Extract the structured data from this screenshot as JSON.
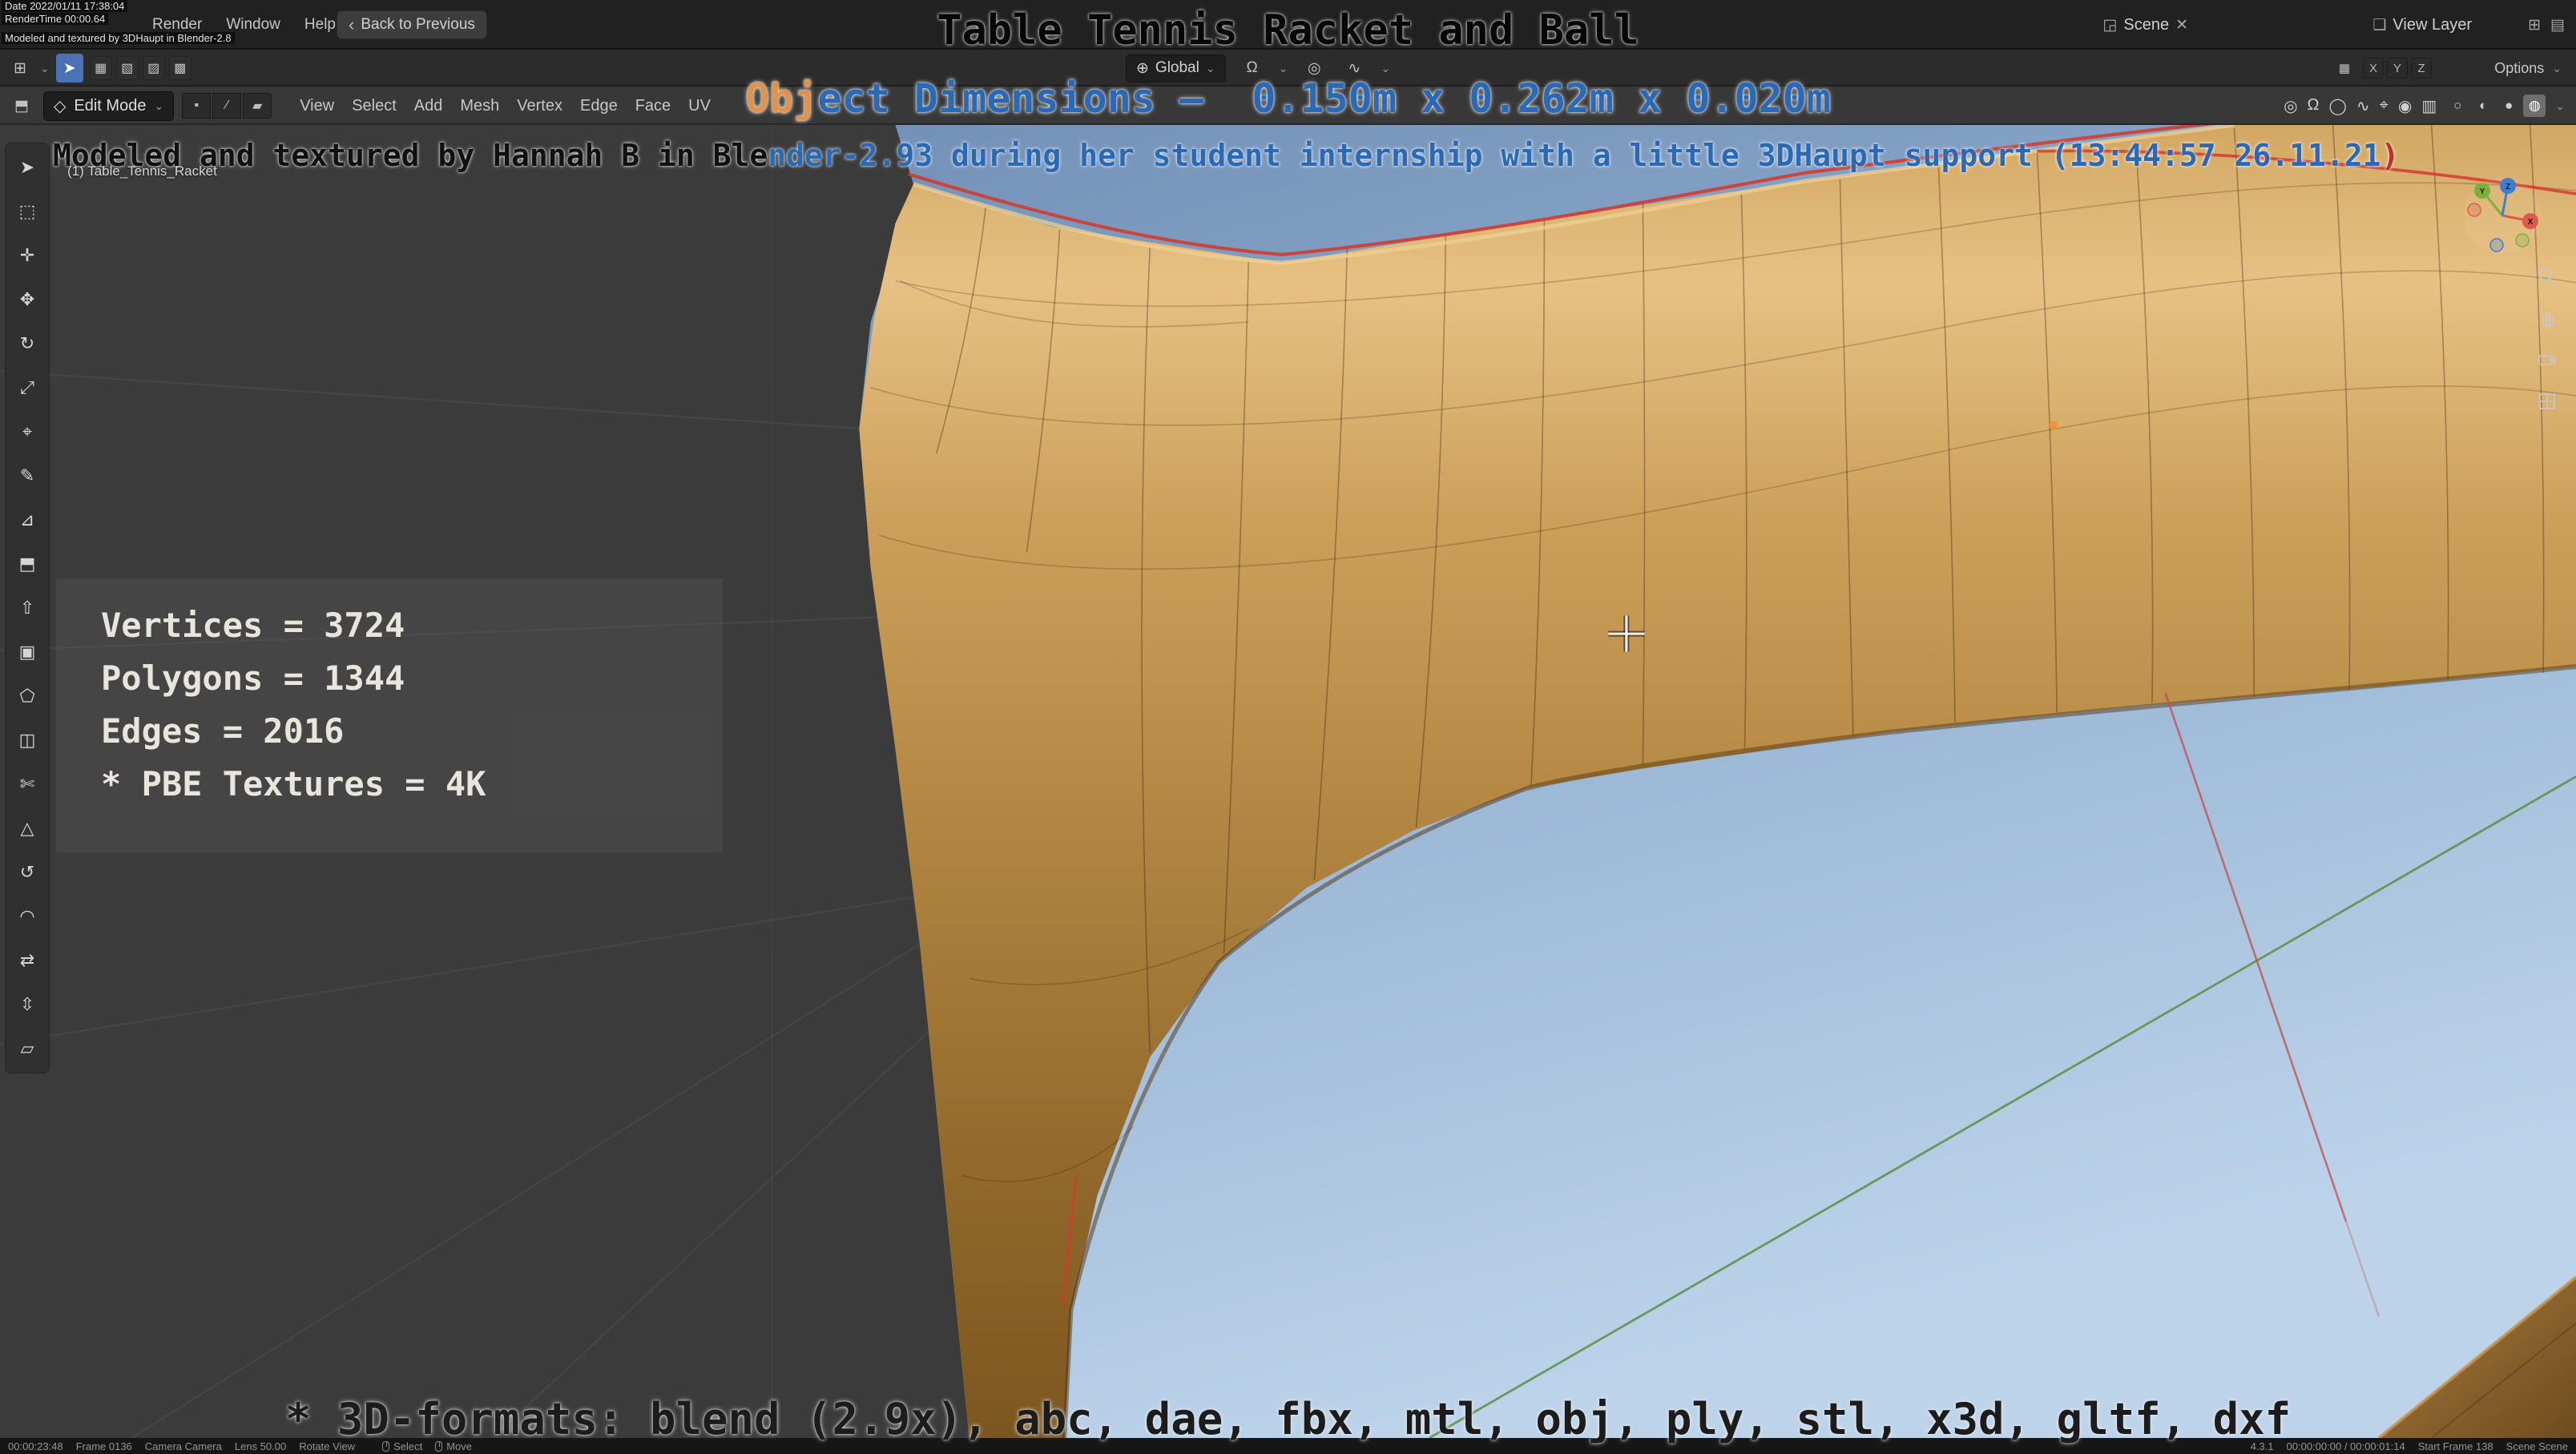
{
  "icons": {
    "caret": "⌄",
    "close": "✕",
    "separator": "|",
    "back_arrow": "‹",
    "scene": "◲",
    "view_layer": "❏",
    "new": "⊞",
    "list": "▤"
  },
  "colors": {
    "dimension_blue": "#2a69b5",
    "overlay_orange": "#e0924f",
    "paren_red": "#c03028",
    "selected_edge_red": "#d23b2e",
    "axis_green": "#5d9141",
    "axis_red": "#c05050",
    "origin_orange": "#ef9336",
    "active_tool_blue": "#4a72b4"
  },
  "topbar": {
    "annotations": {
      "line1": "Date 2022/01/11 17:38:04",
      "line2": "RenderTime 00:00.64",
      "line3": "Modeled and textured by 3DHaupt in Blender-2.8"
    },
    "menus": [
      "Render",
      "Window",
      "Help"
    ],
    "back_button": "Back to Previous",
    "scene_selector": {
      "label": "Scene"
    },
    "view_layer_selector": {
      "label": "View Layer"
    }
  },
  "tool_settings": {
    "editor_icon": "⊞",
    "active_tool_icon": "➤",
    "select_mode_icons": [
      "▦",
      "▧",
      "▨",
      "▩"
    ],
    "orientation": {
      "icon": "⊕",
      "label": "Global"
    },
    "snap_icon": "Ω",
    "proportional_icon": "◎",
    "falloff_icon": "∿",
    "axis_icon": "▦",
    "axis_toggles": [
      "X",
      "Y",
      "Z"
    ],
    "options_label": "Options"
  },
  "viewport_header": {
    "editor_icon": "⬒",
    "mode_icon": "◇",
    "mode_label": "Edit Mode",
    "select_modes": [
      {
        "name": "vertex-select-icon",
        "glyph": "▪"
      },
      {
        "name": "edge-select-icon",
        "glyph": "∕"
      },
      {
        "name": "face-select-icon",
        "glyph": "▰"
      }
    ],
    "menus": [
      "View",
      "Select",
      "Add",
      "Mesh",
      "Vertex",
      "Edge",
      "Face",
      "UV"
    ],
    "right_icons": [
      {
        "name": "pivot-point-icon",
        "glyph": "◎"
      },
      {
        "name": "snap-magnet-icon",
        "glyph": "Ω"
      },
      {
        "name": "proportional-editing-icon",
        "glyph": "◯"
      },
      {
        "name": "falloff-curve-icon",
        "glyph": "∿"
      },
      {
        "name": "show-gizmo-icon",
        "glyph": "⌖"
      },
      {
        "name": "overlays-icon",
        "glyph": "◉"
      },
      {
        "name": "xray-toggle-icon",
        "glyph": "▥"
      }
    ],
    "shading_modes": [
      {
        "name": "wireframe-shading-icon",
        "glyph": "○"
      },
      {
        "name": "solid-shading-icon",
        "glyph": "◐"
      },
      {
        "name": "material-preview-icon",
        "glyph": "●"
      },
      {
        "name": "rendered-shading-icon",
        "glyph": "◍"
      }
    ]
  },
  "overlay_text": {
    "title": "Table Tennis Racket and Ball",
    "dimensions": {
      "part_orange": "Obj",
      "part_blue": "ect Dimensions –  0.150m x 0.262m x 0.020m"
    },
    "credit": {
      "part_dark": "Modeled and textured by Hannah B in Ble",
      "part_blue": "nder-2.93 during her student internship with a little 3DHaupt support (13:44:57 26.11.21",
      "part_red": ")"
    },
    "formats": "* 3D-formats: blend (2.9x), abc, dae, fbx, mtl, obj, ply, stl, x3d, gltf, dxf"
  },
  "viewport": {
    "object_info": "(1) Table_Tennis_Racket",
    "stats": {
      "vertices": "Vertices = 3724",
      "polygons": "Polygons = 1344",
      "edges": "Edges = 2016",
      "textures": "* PBE Textures = 4K"
    }
  },
  "toolbar": {
    "tools": [
      {
        "name": "tweak-select-tool",
        "glyph": "➤"
      },
      {
        "name": "select-box-tool",
        "glyph": "⬚"
      },
      {
        "name": "cursor-3d-tool",
        "glyph": "✛"
      },
      {
        "name": "move-tool",
        "glyph": "✥"
      },
      {
        "name": "rotate-tool",
        "glyph": "↻"
      },
      {
        "name": "scale-tool",
        "glyph": "⤢"
      },
      {
        "name": "transform-tool",
        "glyph": "⌖"
      },
      {
        "name": "annotate-tool",
        "glyph": "✎"
      },
      {
        "name": "measure-tool",
        "glyph": "⊿"
      },
      {
        "name": "add-cube-tool",
        "glyph": "⬒"
      },
      {
        "name": "extrude-region-tool",
        "glyph": "⇧"
      },
      {
        "name": "inset-faces-tool",
        "glyph": "▣"
      },
      {
        "name": "bevel-tool",
        "glyph": "⬠"
      },
      {
        "name": "loop-cut-tool",
        "glyph": "◫"
      },
      {
        "name": "knife-tool",
        "glyph": "✄"
      },
      {
        "name": "poly-build-tool",
        "glyph": "△"
      },
      {
        "name": "spin-tool",
        "glyph": "↺"
      },
      {
        "name": "smooth-tool",
        "glyph": "◠"
      },
      {
        "name": "edge-slide-tool",
        "glyph": "⇄"
      },
      {
        "name": "shrink-fatten-tool",
        "glyph": "⇳"
      },
      {
        "name": "shear-tool",
        "glyph": "▱"
      }
    ]
  },
  "nav_gizmo": {
    "axes": [
      "X",
      "Y",
      "Z"
    ]
  },
  "side_controls": [
    "zoom-icon",
    "pan-hand-icon",
    "camera-view-icon",
    "grid-ortho-icon"
  ],
  "statusbar": {
    "left": [
      "00:00:23:48",
      "Frame 0136",
      "Camera Camera",
      "Lens 50.00",
      "Rotate View"
    ],
    "center": [
      "Select",
      "Move"
    ],
    "right": [
      "4.3.1",
      "00:00:00:00 / 00:00:01:14",
      "Start Frame 138",
      "Scene Scene"
    ]
  }
}
